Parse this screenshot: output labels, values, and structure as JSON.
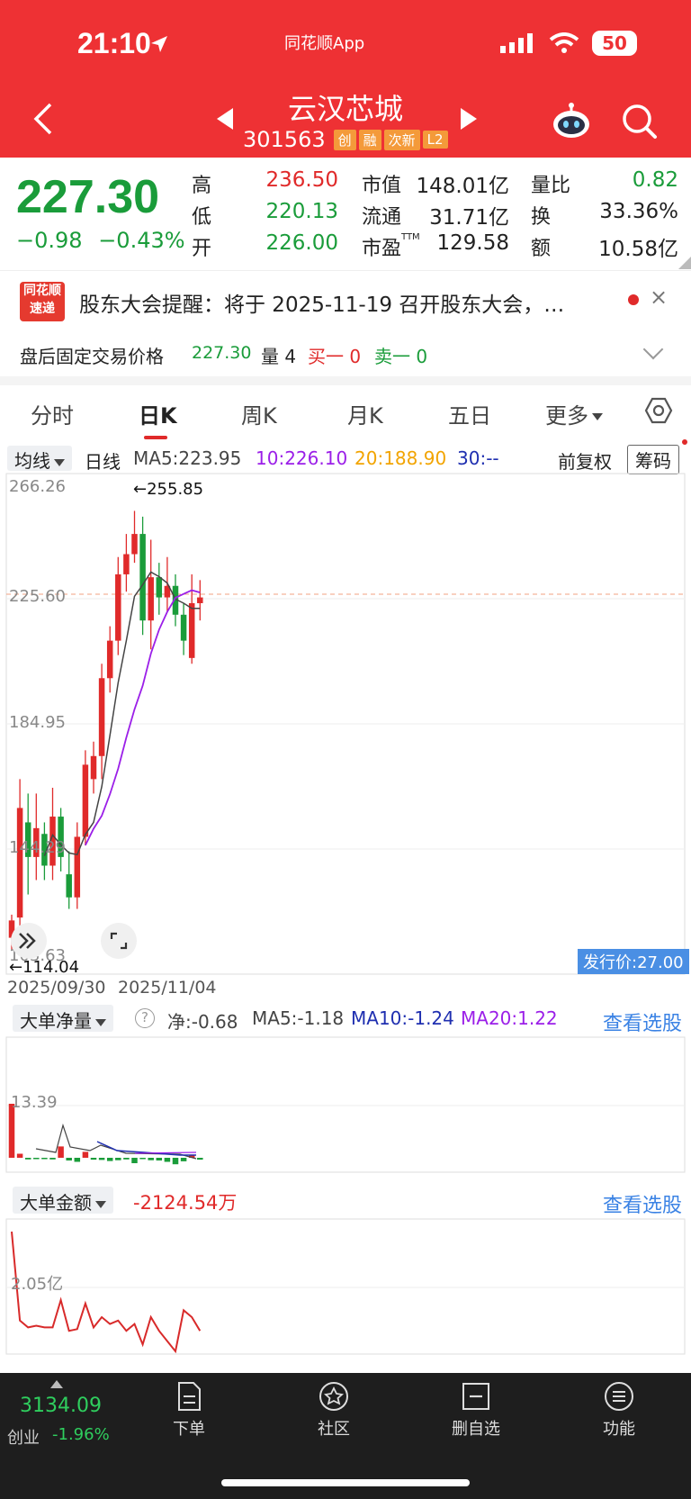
{
  "status": {
    "time": "21:10",
    "app": "同花顺App",
    "battery": "50"
  },
  "header": {
    "title": "云汉芯城",
    "code": "301563",
    "tags": [
      "创",
      "融",
      "次新",
      "L2"
    ]
  },
  "quote": {
    "price": "227.30",
    "change": "−0.98",
    "change_pct": "−0.43%",
    "high_label": "高",
    "high": "236.50",
    "low_label": "低",
    "low": "220.13",
    "open_label": "开",
    "open": "226.00",
    "mktcap_label": "市值",
    "mktcap": "148.01亿",
    "float_label": "流通",
    "float": "31.71亿",
    "pe_label": "市盈",
    "pe_sup": "TTM",
    "pe": "129.58",
    "volratio_label": "量比",
    "volratio": "0.82",
    "turnover_label": "换",
    "turnover": "33.36%",
    "amount_label": "额",
    "amount": "10.58亿"
  },
  "notice": {
    "logo_line1": "同花顺",
    "logo_line2": "速递",
    "text": "股东大会提醒：将于 2025-11-19 召开股东大会，…",
    "close": "×"
  },
  "afterhours": {
    "label": "盘后固定交易价格",
    "price": "227.30",
    "volume": "量 4",
    "buy1": "买一 0",
    "sell1": "卖一 0"
  },
  "tabs": [
    {
      "label": "分时"
    },
    {
      "label": "日K"
    },
    {
      "label": "周K"
    },
    {
      "label": "月K"
    },
    {
      "label": "五日"
    },
    {
      "label": "更多"
    }
  ],
  "ma_row": {
    "select": "均线",
    "period": "日线",
    "ma5": "MA5:223.95",
    "ma10": "10:226.10",
    "ma20": "20:188.90",
    "ma30": "30:--",
    "fuquan": "前复权",
    "chouma": "筹码"
  },
  "kchart": {
    "y_labels": [
      "266.26",
      "225.60",
      "184.95",
      "144.29",
      "103.63"
    ],
    "high_marker": "←255.85",
    "low_marker": "←114.04",
    "dates": [
      "2025/09/30",
      "2025/11/04"
    ],
    "issue_price": "发行价:27.00",
    "colors": {
      "up": "#E02A2A",
      "down": "#1A9C3A",
      "ma5": "#444444",
      "ma10": "#9B1FE8"
    }
  },
  "chart_data": {
    "type": "candlestick",
    "ylim": [
      103.63,
      266.26
    ],
    "candles": [
      {
        "o": 110,
        "c": 116,
        "h": 118,
        "l": 106
      },
      {
        "o": 117,
        "c": 155,
        "h": 165,
        "l": 112
      },
      {
        "o": 150,
        "c": 138,
        "h": 160,
        "l": 125
      },
      {
        "o": 138,
        "c": 148,
        "h": 160,
        "l": 130
      },
      {
        "o": 146,
        "c": 135,
        "h": 150,
        "l": 130
      },
      {
        "o": 135,
        "c": 152,
        "h": 162,
        "l": 130
      },
      {
        "o": 152,
        "c": 138,
        "h": 155,
        "l": 133
      },
      {
        "o": 132,
        "c": 124,
        "h": 140,
        "l": 120
      },
      {
        "o": 124,
        "c": 145,
        "h": 150,
        "l": 120
      },
      {
        "o": 145,
        "c": 170,
        "h": 175,
        "l": 142
      },
      {
        "o": 165,
        "c": 173,
        "h": 178,
        "l": 160
      },
      {
        "o": 173,
        "c": 200,
        "h": 205,
        "l": 165
      },
      {
        "o": 200,
        "c": 213,
        "h": 218,
        "l": 195
      },
      {
        "o": 213,
        "c": 236,
        "h": 242,
        "l": 208
      },
      {
        "o": 236,
        "c": 243,
        "h": 250,
        "l": 230
      },
      {
        "o": 243,
        "c": 250,
        "h": 258,
        "l": 240
      },
      {
        "o": 250,
        "c": 220,
        "h": 256,
        "l": 215
      },
      {
        "o": 220,
        "c": 235,
        "h": 248,
        "l": 210
      },
      {
        "o": 235,
        "c": 228,
        "h": 240,
        "l": 222
      },
      {
        "o": 228,
        "c": 232,
        "h": 242,
        "l": 223
      },
      {
        "o": 232,
        "c": 222,
        "h": 236,
        "l": 218
      },
      {
        "o": 222,
        "c": 213,
        "h": 226,
        "l": 208
      },
      {
        "o": 207,
        "c": 226,
        "h": 236,
        "l": 205
      },
      {
        "o": 226,
        "c": 228,
        "h": 234,
        "l": 220
      }
    ]
  },
  "net_panel": {
    "select": "大单净量",
    "help": "?",
    "net": "净:-0.68",
    "ma5": "MA5:-1.18",
    "ma10": "MA10:-1.24",
    "ma20": "MA20:1.22",
    "link": "查看选股",
    "y_label": "13.39",
    "values": [
      20,
      1.5,
      -0.6,
      -0.4,
      -0.5,
      -0.6,
      4.2,
      -1.0,
      -1.5,
      2.2,
      -0.7,
      -0.8,
      -1.2,
      -0.9,
      -0.6,
      -2.0,
      -0.5,
      -0.9,
      -1.0,
      -1.5,
      -2.4,
      -1.3,
      1.0,
      -0.7
    ],
    "colors": {
      "up": "#E02A2A",
      "down": "#1A9C3A"
    }
  },
  "amount_panel": {
    "select": "大单金额",
    "value": "-2124.54万",
    "link": "查看选股",
    "y_label": "2.05亿",
    "values": [
      3.0,
      0.4,
      0.2,
      0.25,
      0.2,
      0.2,
      1.0,
      0.1,
      0.15,
      0.9,
      0.2,
      0.5,
      0.3,
      0.4,
      0.1,
      0.3,
      -0.3,
      0.5,
      0.1,
      -0.2,
      -0.5,
      0.7,
      0.5,
      0.1
    ]
  },
  "bottombar": {
    "index_value": "3134.09",
    "index_name": "创业",
    "index_chg": "-1.96%",
    "items": [
      {
        "label": "下单"
      },
      {
        "label": "社区"
      },
      {
        "label": "删自选"
      },
      {
        "label": "功能"
      }
    ]
  }
}
